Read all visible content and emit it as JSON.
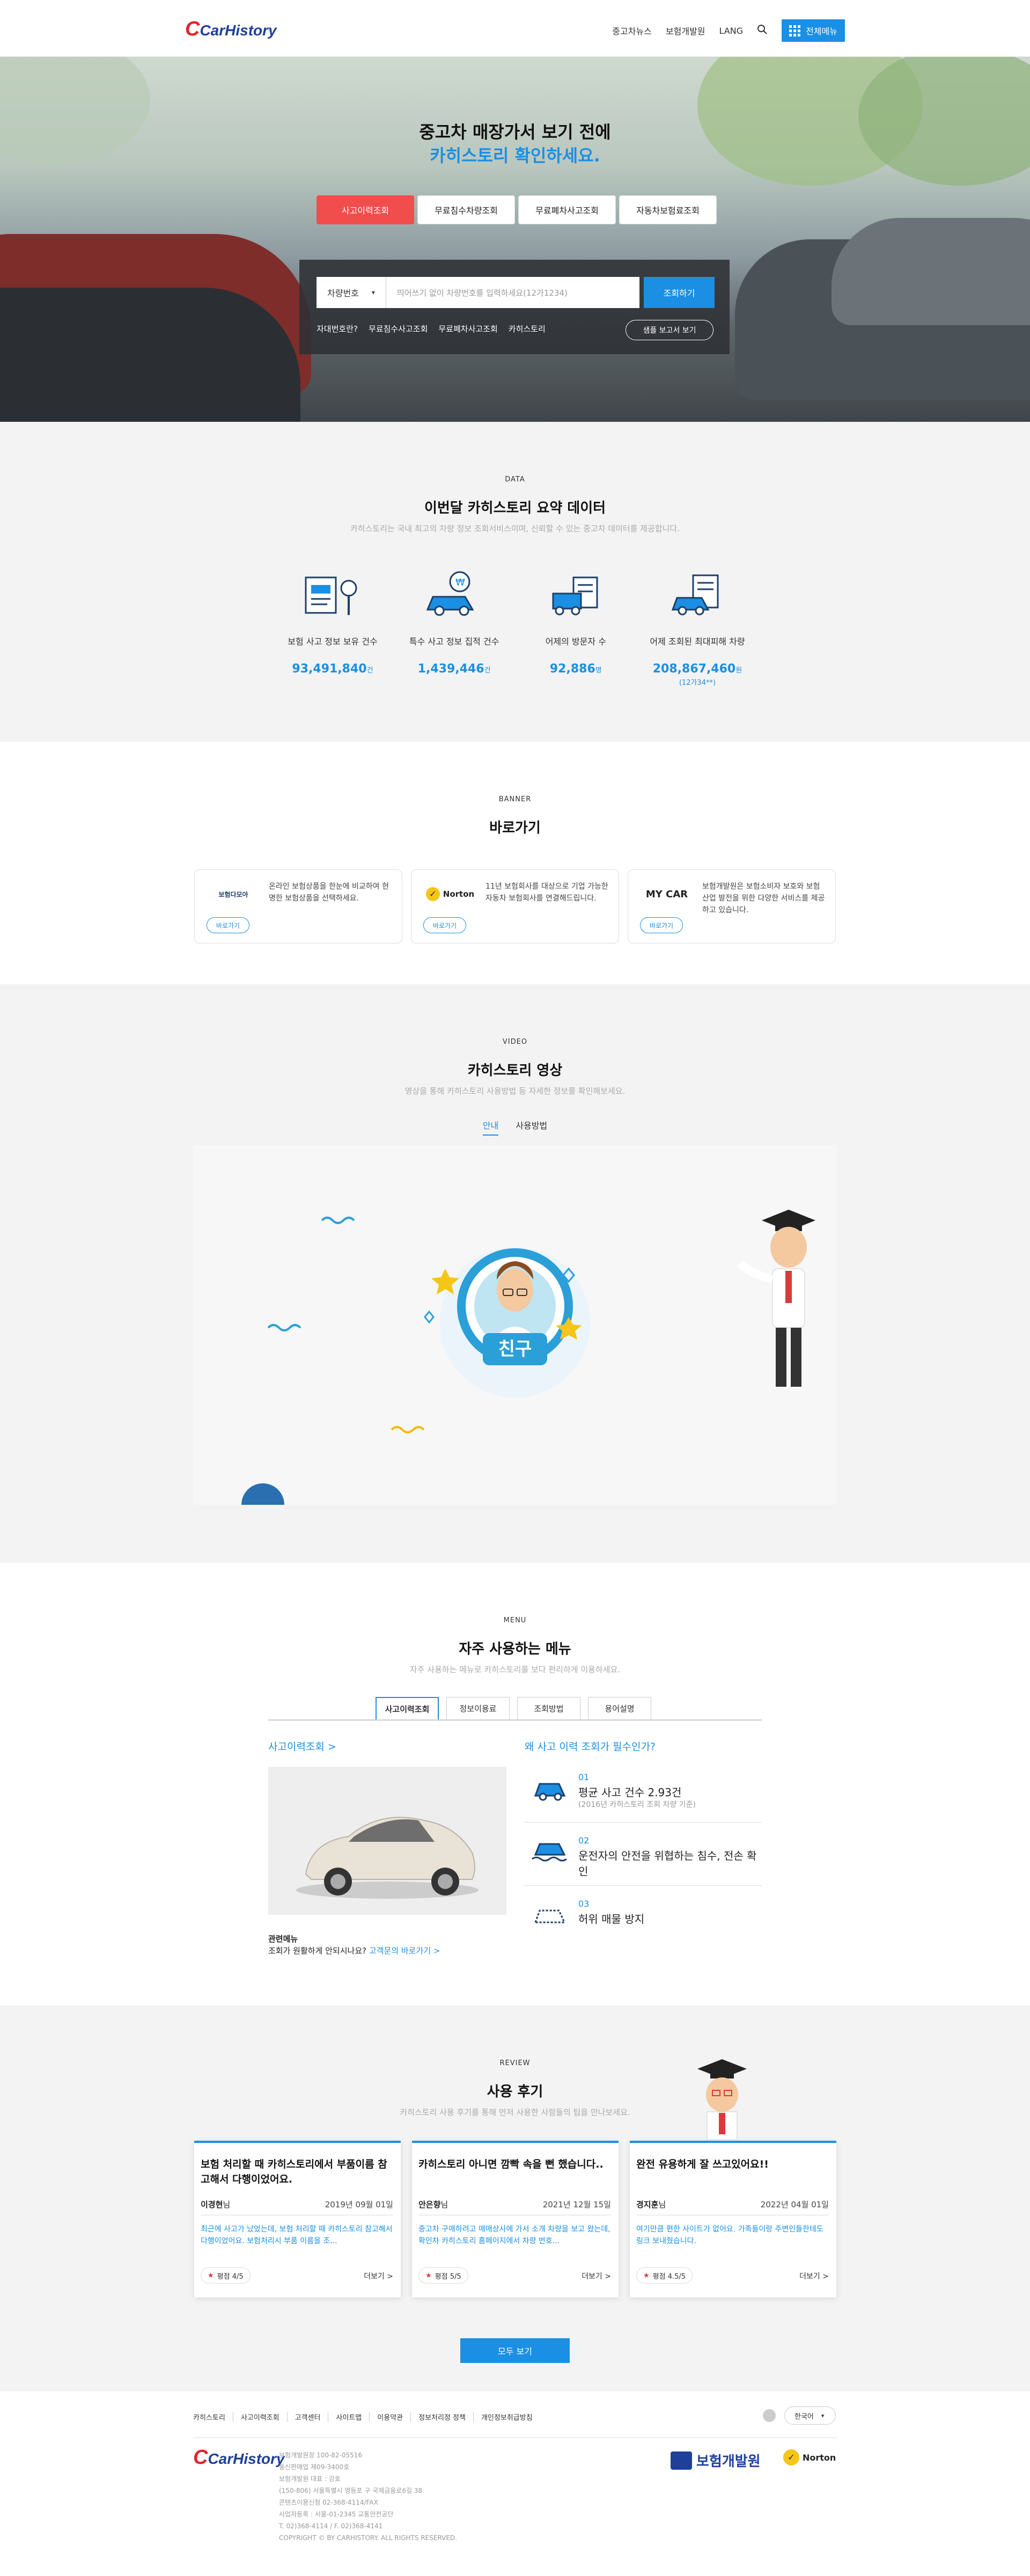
{
  "header": {
    "logo": "CarHistory",
    "nav": [
      "중고차뉴스",
      "보험개발원",
      "LANG"
    ],
    "all_menu": "전체메뉴"
  },
  "hero": {
    "title_line1": "중고차 매장가서 보기 전에",
    "title_line2": "카히스토리 확인하세요.",
    "tabs": [
      "사고이력조회",
      "무료침수차량조회",
      "무료폐차사고조회",
      "자동차보험료조회"
    ],
    "select_value": "차량번호",
    "input_placeholder": "띄어쓰기 없이 차량번호를 입력하세요(12가1234)",
    "search_button": "조회하기",
    "links": [
      "자대번호란?",
      "무료침수사고조회",
      "무료폐차사고조회",
      "카히스토리"
    ],
    "sample_button": "샘플 보고서 보기"
  },
  "data_section": {
    "eyebrow": "DATA",
    "title": "이번달 카히스토리 요약 데이터",
    "subtitle": "카히스토리는 국내 최고의 차량 정보 조회서비스이며, 신뢰할 수 있는 중고차 데이터를 제공합니다.",
    "stats": [
      {
        "label": "보험 사고 정보 보유 건수",
        "value": "93,491,840",
        "unit": "건",
        "note": ""
      },
      {
        "label": "특수 사고 정보 집적 건수",
        "value": "1,439,446",
        "unit": "건",
        "note": ""
      },
      {
        "label": "어제의 방문자 수",
        "value": "92,886",
        "unit": "명",
        "note": ""
      },
      {
        "label": "어제 조회된 최대피해 차량",
        "value": "208,867,460",
        "unit": "원",
        "note": "(12가34**)"
      }
    ]
  },
  "banner_section": {
    "eyebrow": "BANNER",
    "title": "바로가기",
    "cards": [
      {
        "logo": "보험다모아",
        "text": "온라인 보험상품을 한눈에 비교하여 현명한 보험상품을 선택하세요.",
        "button": "바로가기"
      },
      {
        "logo": "Norton",
        "text": "11년 보험회사를 대상으로 기업 가능한 자동차 보험회사를 연결해드립니다.",
        "button": "바로가기"
      },
      {
        "logo": "MY CAR",
        "text": "보험개발원은 보험소비자 보호와 보험산업 발전을 위한 다양한 서비스를 제공하고 있습니다.",
        "button": "바로가기"
      }
    ]
  },
  "video_section": {
    "eyebrow": "VIDEO",
    "title": "카히스토리 영상",
    "subtitle": "영상을 통해 카히스토리 사용방법 등 자세한 정보를 확인해보세요.",
    "tabs": [
      "안내",
      "사용방법"
    ],
    "badge": "친구"
  },
  "menu_section": {
    "eyebrow": "MENU",
    "title": "자주 사용하는 메뉴",
    "subtitle": "자주 사용하는 메뉴로 카히스토리를 보다 편리하게 이용하세요.",
    "tabs": [
      "사고이력조회",
      "정보이용료",
      "조회방법",
      "용어설명"
    ],
    "left_link": "사고이력조회 >",
    "related_title": "관련메뉴",
    "related_text": "조회가 원활하게 안되시나요?",
    "related_link": "고객문의 바로가기 >",
    "right_title": "왜 사고 이력 조회가 필수인가?",
    "reasons": [
      {
        "num": "01",
        "title": "평균 사고 건수 2.93건",
        "sub": "(2016년 카히스토리 조회 차량 기준)"
      },
      {
        "num": "02",
        "title": "운전자의 안전을 위협하는 침수, 전손 확인",
        "sub": ""
      },
      {
        "num": "03",
        "title": "허위 매물 방지",
        "sub": ""
      }
    ]
  },
  "review_section": {
    "eyebrow": "REVIEW",
    "title": "사용 후기",
    "subtitle": "카히스토리 사용 후기를 통해 먼저 사용한 사람들의 팁을 만나보세요.",
    "cards": [
      {
        "title": "보험 처리할 때 카히스토리에서 부품이름 참고해서 다행이었어요.",
        "author": "이경현",
        "suffix": "님",
        "date": "2019년 09월 01일",
        "body": "최근에 사고가 났었는데, 보험 처리할 때 카히스토리 참고해서 다행이었어요. 보험처리시 부품 이름을 조...",
        "score": "평점 4/5",
        "more": "더보기 >"
      },
      {
        "title": "카히스토리 아니면 깜빡 속을 뻔 했습니다..",
        "author": "안은향",
        "suffix": "님",
        "date": "2021년 12월 15일",
        "body": "중고차 구매하려고 매매상사에 가서 소개 차량을 보고 왔는데, 확인차 카히스토리 홈페이지에서 차량 번호...",
        "score": "평점 5/5",
        "more": "더보기 >"
      },
      {
        "title": "완전 유용하게 잘 쓰고있어요!!",
        "author": "경지훈",
        "suffix": "님",
        "date": "2022년 04월 01일",
        "body": "여기만큼 편한 사이트가 없어요. 가족들이랑 주변인들한테도 링크 보내줬습니다.",
        "score": "평점 4.5/5",
        "more": "더보기 >"
      }
    ],
    "all_button": "모두 보기"
  },
  "footer": {
    "links": [
      "카히스토리",
      "사고이력조회",
      "고객센터",
      "사이트맵",
      "이용약관",
      "정보처리정 정책",
      "개인정보취급방침"
    ],
    "language": "한국어",
    "logo": "CarHistory",
    "info": [
      "보험개발원장 100-82-05516",
      "통신판매업 제09-3400호",
      "보험개발원 대표 : 강호",
      "(150-806) 서울특별시 영등포 구 국제금융로6길 38",
      "콘텐츠이용신청 02-368-4114/FAX",
      "사업자등록 : 서울-01-2345 교통안전공단",
      "T. 02)368-4114 / F. 02)368-4141",
      "COPYRIGHT © BY CARHISTORY. ALL RIGHTS RESERVED."
    ],
    "partner1": "보험개발원",
    "partner2": "Norton"
  }
}
